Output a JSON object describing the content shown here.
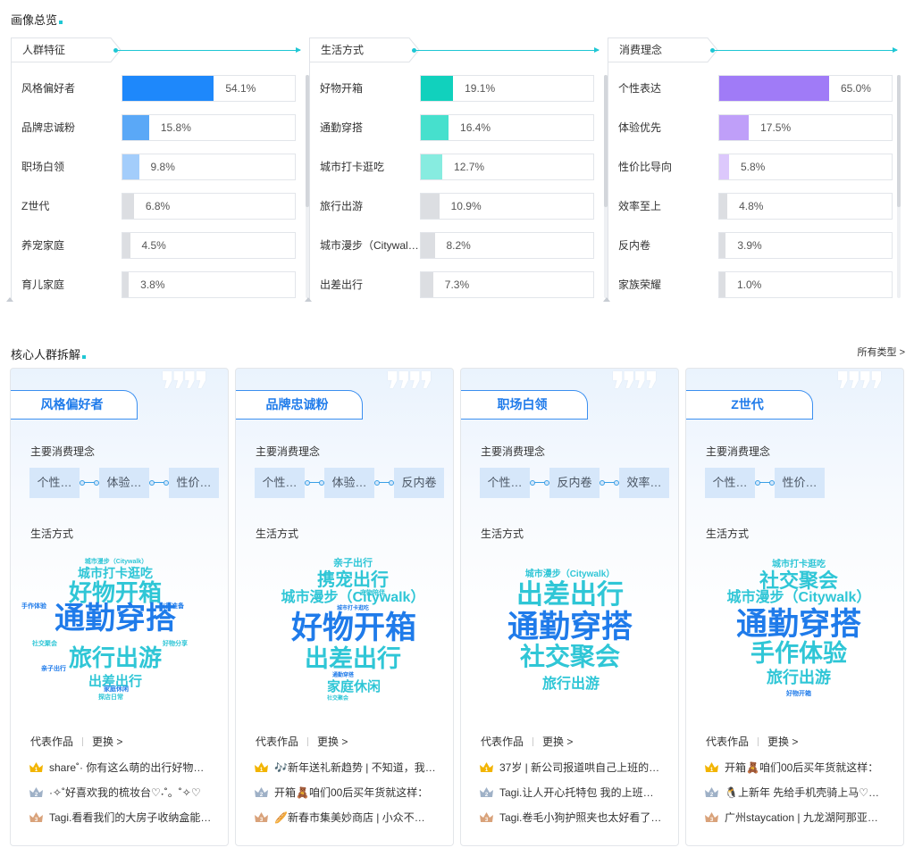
{
  "overview": {
    "title": "画像总览",
    "columns": [
      {
        "tab": "人群特征",
        "rows": [
          {
            "label": "风格偏好者",
            "value": 54.1,
            "text": "54.1%",
            "color": "#1e88fb"
          },
          {
            "label": "品牌忠诚粉",
            "value": 15.8,
            "text": "15.8%",
            "color": "#5aa8f7"
          },
          {
            "label": "职场白领",
            "value": 9.8,
            "text": "9.8%",
            "color": "#a3cdfb"
          },
          {
            "label": "Z世代",
            "value": 6.8,
            "text": "6.8%",
            "color": "#dcdee2"
          },
          {
            "label": "养宠家庭",
            "value": 4.5,
            "text": "4.5%",
            "color": "#dcdee2"
          },
          {
            "label": "育儿家庭",
            "value": 3.8,
            "text": "3.8%",
            "color": "#dcdee2"
          }
        ]
      },
      {
        "tab": "生活方式",
        "rows": [
          {
            "label": "好物开箱",
            "value": 19.1,
            "text": "19.1%",
            "color": "#11d1bd"
          },
          {
            "label": "通勤穿搭",
            "value": 16.4,
            "text": "16.4%",
            "color": "#46e0cd"
          },
          {
            "label": "城市打卡逛吃",
            "value": 12.7,
            "text": "12.7%",
            "color": "#87ece0"
          },
          {
            "label": "旅行出游",
            "value": 10.9,
            "text": "10.9%",
            "color": "#dcdee2"
          },
          {
            "label": "城市漫步（Citywalk）",
            "value": 8.2,
            "text": "8.2%",
            "color": "#dcdee2"
          },
          {
            "label": "出差出行",
            "value": 7.3,
            "text": "7.3%",
            "color": "#dcdee2"
          }
        ]
      },
      {
        "tab": "消费理念",
        "rows": [
          {
            "label": "个性表达",
            "value": 65.0,
            "text": "65.0%",
            "color": "#a07bf7"
          },
          {
            "label": "体验优先",
            "value": 17.5,
            "text": "17.5%",
            "color": "#bf9ff9"
          },
          {
            "label": "性价比导向",
            "value": 5.8,
            "text": "5.8%",
            "color": "#dcc8fc"
          },
          {
            "label": "效率至上",
            "value": 4.8,
            "text": "4.8%",
            "color": "#dcdee2"
          },
          {
            "label": "反内卷",
            "value": 3.9,
            "text": "3.9%",
            "color": "#dcdee2"
          },
          {
            "label": "家族荣耀",
            "value": 1.0,
            "text": "1.0%",
            "color": "#dcdee2"
          }
        ]
      }
    ]
  },
  "core": {
    "title": "核心人群拆解",
    "all_types": "所有类型 >",
    "consume_label": "主要消费理念",
    "life_label": "生活方式",
    "works_label": "代表作品",
    "change_label": "更换 >",
    "cards": [
      {
        "name": "风格偏好者",
        "chips": [
          "个性…",
          "体验…",
          "性价…"
        ],
        "cloud": [
          {
            "t": "城市漫步（Citywalk）",
            "s": 7,
            "c": "#2fc6d6"
          },
          {
            "t": "城市打卡逛吃",
            "s": 14,
            "c": "#2fc6d6"
          },
          {
            "t": "好物开箱",
            "s": 26,
            "c": "#2fc6d6"
          },
          {
            "t": "手作体验",
            "s": 7,
            "c": "#1f7bea"
          },
          {
            "t": "出行准备",
            "s": 7,
            "c": "#1f7bea"
          },
          {
            "t": "通勤穿搭",
            "s": 34,
            "c": "#1f7bea"
          },
          {
            "t": "社交聚会",
            "s": 7,
            "c": "#2fc6d6"
          },
          {
            "t": "好物分享",
            "s": 7,
            "c": "#2fc6d6"
          },
          {
            "t": "旅行出游",
            "s": 26,
            "c": "#2fc6d6"
          },
          {
            "t": "亲子出行",
            "s": 7,
            "c": "#1f7bea"
          },
          {
            "t": "出差出行",
            "s": 15,
            "c": "#2fc6d6"
          },
          {
            "t": "家庭休闲",
            "s": 7,
            "c": "#1f7bea"
          },
          {
            "t": "探店日常",
            "s": 7,
            "c": "#2fc6d6"
          }
        ],
        "works": [
          "share˚· 你有这么萌的出行好物…",
          "·✧˚好喜欢我的梳妆台♡˖˚。˚✧♡",
          "Tagi.看看我们的大房子收纳盒能…"
        ]
      },
      {
        "name": "品牌忠诚粉",
        "chips": [
          "个性…",
          "体验…",
          "反内卷"
        ],
        "cloud": [
          {
            "t": "亲子出行",
            "s": 11,
            "c": "#2fc6d6"
          },
          {
            "t": "携宠出行",
            "s": 20,
            "c": "#2fc6d6"
          },
          {
            "t": "宠物陪伴",
            "s": 7,
            "c": "#2fc6d6"
          },
          {
            "t": "城市漫步（Citywalk）",
            "s": 16,
            "c": "#2fc6d6"
          },
          {
            "t": "城市打卡逛吃",
            "s": 6,
            "c": "#1f7bea"
          },
          {
            "t": "好物开箱",
            "s": 35,
            "c": "#1f7bea"
          },
          {
            "t": "出差出行",
            "s": 27,
            "c": "#2fc6d6"
          },
          {
            "t": "通勤穿搭",
            "s": 6,
            "c": "#1f7bea"
          },
          {
            "t": "家庭休闲",
            "s": 15,
            "c": "#2fc6d6"
          },
          {
            "t": "社交聚会",
            "s": 6,
            "c": "#2fc6d6"
          }
        ],
        "works": [
          "🎶新年送礼新趋势 | 不知道，我…",
          "开箱🧸咱们00后买年货就这样：",
          "🥖新春市集美妙商店 | 小众不…"
        ]
      },
      {
        "name": "职场白领",
        "chips": [
          "个性…",
          "反内卷",
          "效率…"
        ],
        "cloud": [
          {
            "t": "城市漫步（Citywalk）",
            "s": 10,
            "c": "#2fc6d6"
          },
          {
            "t": "出差出行",
            "s": 30,
            "c": "#2fc6d6"
          },
          {
            "t": "通勤穿搭",
            "s": 35,
            "c": "#1f7bea"
          },
          {
            "t": "社交聚会",
            "s": 28,
            "c": "#2fc6d6"
          },
          {
            "t": "旅行出游",
            "s": 16,
            "c": "#2fc6d6"
          }
        ],
        "works": [
          "37岁 | 新公司报道哄自己上班的…",
          "Tagi.让人开心托特包 我的上班…",
          "Tagi.卷毛小狗护照夹也太好看了…"
        ]
      },
      {
        "name": "Z世代",
        "chips": [
          "个性…",
          "性价…"
        ],
        "cloud": [
          {
            "t": "城市打卡逛吃",
            "s": 10,
            "c": "#2fc6d6"
          },
          {
            "t": "社交聚会",
            "s": 22,
            "c": "#2fc6d6"
          },
          {
            "t": "城市漫步（Citywalk）",
            "s": 16,
            "c": "#2fc6d6"
          },
          {
            "t": "通勤穿搭",
            "s": 35,
            "c": "#1f7bea"
          },
          {
            "t": "手作体验",
            "s": 27,
            "c": "#2fc6d6"
          },
          {
            "t": "旅行出游",
            "s": 18,
            "c": "#2fc6d6"
          },
          {
            "t": "好物开箱",
            "s": 7,
            "c": "#1f7bea"
          }
        ],
        "works": [
          "开箱🧸咱们00后买年货就这样：",
          "🐧上新年 先给手机壳骑上马♡…",
          "广州staycation | 九龙湖阿那亚…"
        ]
      }
    ]
  }
}
